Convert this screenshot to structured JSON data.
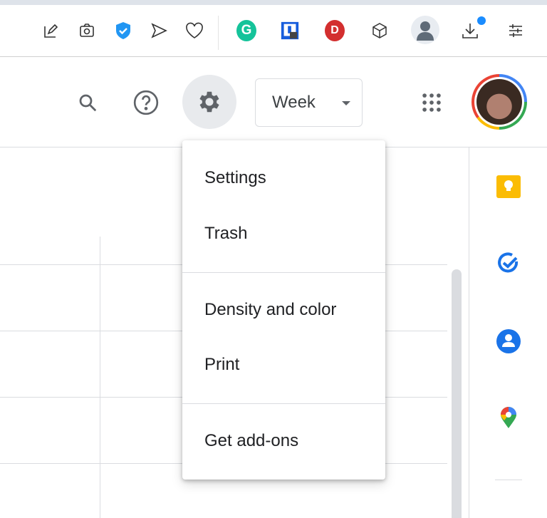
{
  "browser_toolbar": {
    "icons": [
      "edit-pin-icon",
      "camera-icon",
      "shield-check-icon",
      "send-icon",
      "heart-icon",
      "grammarly-icon",
      "bitwarden-icon",
      "d-extension-icon",
      "cube-icon",
      "profile-icon",
      "download-icon",
      "sliders-icon"
    ],
    "grammarly_letter": "G",
    "d_letter": "D"
  },
  "header": {
    "view_selector": "Week"
  },
  "settings_menu": {
    "items": [
      "Settings",
      "Trash",
      "Density and color",
      "Print",
      "Get add-ons"
    ]
  },
  "colors": {
    "accent": "#1a73e8",
    "keep": "#fbbc04",
    "grammarly": "#15c39a",
    "d_ext": "#d32f2f"
  }
}
